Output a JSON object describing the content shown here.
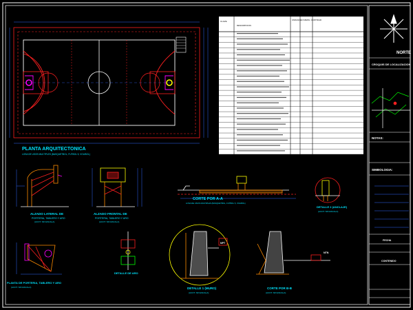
{
  "labels": {
    "plan_title": "PLANTA ARQUITECTONICA",
    "plan_subtitle": "LOSA DE USOS MULTIPLES (BASQUETBOL, FUTBOL 5, VOLIBOL)",
    "lateral_title": "ALZADO LATERAL DE",
    "lateral_sub": "PORTERIA, TABLERO Y ARO",
    "lateral_scale": "(ACOT. SIN ESCALA)",
    "frontal_title": "ALZADO FRONTAL DE",
    "frontal_sub": "PORTERIA, TABLERO Y ARO",
    "frontal_scale": "(ACOT. SIN ESCALA)",
    "corte_aa": "CORTE POR A-A",
    "corte_aa_sub": "LOSA DE USOS MULTIPLES (BASQUETBOL, FUTBOL 5, VOLIBOL)",
    "detalle2": "DETALLE 2 (ANCLAJE)",
    "detalle2_sub": "(ACOT. SIN ESCALA)",
    "planta_porteria": "PLANTA DE PORTERIA, TABLERO Y ARO",
    "planta_porteria_sub": "(ACOT. SIN ESCALA)",
    "detalle_aro": "DETALLE DE ARO",
    "detalle1": "DETALLE 1 (MURO)",
    "detalle1_sub": "(ACOT. SIN ESCALA)",
    "corte_bb": "CORTE POR B-B",
    "corte_bb_sub": "(ACOT. SIN ESCALA)",
    "npt": "NPT",
    "ntn": "NTN"
  },
  "table": {
    "head_left": "CLAVE",
    "head_mid": "DESCRIPCION",
    "head_right": "UNIDAD EN MENS. CANTIDAD",
    "rows": [
      "",
      "",
      "",
      "",
      "",
      "",
      "",
      "",
      "",
      "",
      "",
      "",
      "",
      "",
      "",
      "",
      "",
      "",
      "",
      "",
      "",
      "",
      ""
    ]
  },
  "titleblock": {
    "brand": "NORTE",
    "croquis": "CROQUIS DE LOCALIZACION",
    "notas": "NOTAS:",
    "simbologia": "SIMBOLOGIA:",
    "fecha": "FECHA",
    "contenido": "CONTENIDO"
  },
  "colors": {
    "background": "#000000",
    "frame": "#ffffff",
    "court": "#ff2020",
    "title_text": "#00e5ff",
    "detail_yellow": "#ffff00",
    "table_text": "#ffffff",
    "dim_blue": "#3366ff",
    "green": "#00ff00",
    "magenta": "#ff00ff"
  }
}
